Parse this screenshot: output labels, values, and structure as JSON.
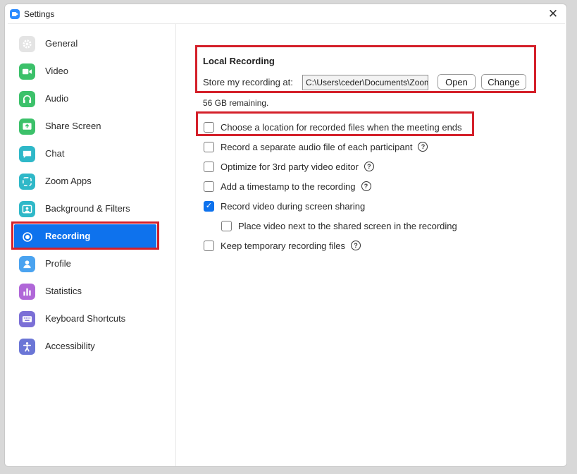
{
  "window": {
    "title": "Settings",
    "close_glyph": "✕"
  },
  "sidebar": {
    "items": [
      {
        "label": "General",
        "icon": "gear-icon",
        "color": "#e7e7e7"
      },
      {
        "label": "Video",
        "icon": "video-camera-icon",
        "color": "#3cc16a"
      },
      {
        "label": "Audio",
        "icon": "headphones-icon",
        "color": "#3cc16a"
      },
      {
        "label": "Share Screen",
        "icon": "share-screen-icon",
        "color": "#3cc16a"
      },
      {
        "label": "Chat",
        "icon": "chat-bubble-icon",
        "color": "#2fb8c8"
      },
      {
        "label": "Zoom Apps",
        "icon": "apps-icon",
        "color": "#2fb8c8"
      },
      {
        "label": "Background & Filters",
        "icon": "background-icon",
        "color": "#2fb8c8"
      },
      {
        "label": "Recording",
        "icon": "record-icon",
        "color": "#0e72ed"
      },
      {
        "label": "Profile",
        "icon": "profile-icon",
        "color": "#4aa3f0"
      },
      {
        "label": "Statistics",
        "icon": "statistics-icon",
        "color": "#b067d8"
      },
      {
        "label": "Keyboard Shortcuts",
        "icon": "keyboard-icon",
        "color": "#7b6fd6"
      },
      {
        "label": "Accessibility",
        "icon": "accessibility-icon",
        "color": "#6b76d6"
      }
    ],
    "active": "Recording"
  },
  "recording": {
    "section_title": "Local Recording",
    "store_label": "Store my recording at:",
    "path_value": "C:\\Users\\ceder\\Documents\\Zoom",
    "open_label": "Open",
    "change_label": "Change",
    "remaining": "56 GB remaining.",
    "options": [
      {
        "label": "Choose a location for recorded files when the meeting ends",
        "checked": false,
        "help": false
      },
      {
        "label": "Record a separate audio file of each participant",
        "checked": false,
        "help": true
      },
      {
        "label": "Optimize for 3rd party video editor",
        "checked": false,
        "help": true
      },
      {
        "label": "Add a timestamp to the recording",
        "checked": false,
        "help": true
      },
      {
        "label": "Record video during screen sharing",
        "checked": true,
        "help": false
      },
      {
        "label": "Place video next to the shared screen in the recording",
        "checked": false,
        "help": false
      },
      {
        "label": "Keep temporary recording files",
        "checked": false,
        "help": true
      }
    ],
    "help_glyph": "?",
    "check_glyph": "✓"
  },
  "colors": {
    "accent": "#0e72ed",
    "highlight": "#d4202a"
  }
}
